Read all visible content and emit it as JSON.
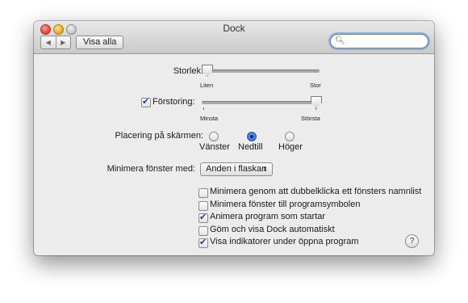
{
  "window": {
    "title": "Dock",
    "show_all_label": "Visa alla",
    "search_placeholder": ""
  },
  "settings": {
    "size": {
      "label": "Storlek:",
      "min_label": "Liten",
      "max_label": "Stor",
      "value": 0.0
    },
    "magnification": {
      "checkbox_checked": true,
      "label": "Förstoring:",
      "min_label": "Minsta",
      "max_label": "Största",
      "value": 1.0
    },
    "position": {
      "label": "Placering på skärmen:",
      "options": [
        {
          "label": "Vänster",
          "selected": false
        },
        {
          "label": "Nedtill",
          "selected": true
        },
        {
          "label": "Höger",
          "selected": false
        }
      ]
    },
    "minimize_effect": {
      "label": "Minimera fönster med:",
      "value": "Anden i flaskan"
    },
    "checkboxes": [
      {
        "label": "Minimera genom att dubbelklicka ett fönsters namnlist",
        "checked": false
      },
      {
        "label": "Minimera fönster till programsymbolen",
        "checked": false
      },
      {
        "label": "Animera program som startar",
        "checked": true
      },
      {
        "label": "Göm och visa Dock automatiskt",
        "checked": false
      },
      {
        "label": "Visa indikatorer under öppna program",
        "checked": true
      }
    ]
  },
  "help_label": "?",
  "icons": {
    "back": "chevron-left-icon",
    "forward": "chevron-right-icon",
    "search": "search-icon",
    "popup": "updown-arrows-icon"
  }
}
